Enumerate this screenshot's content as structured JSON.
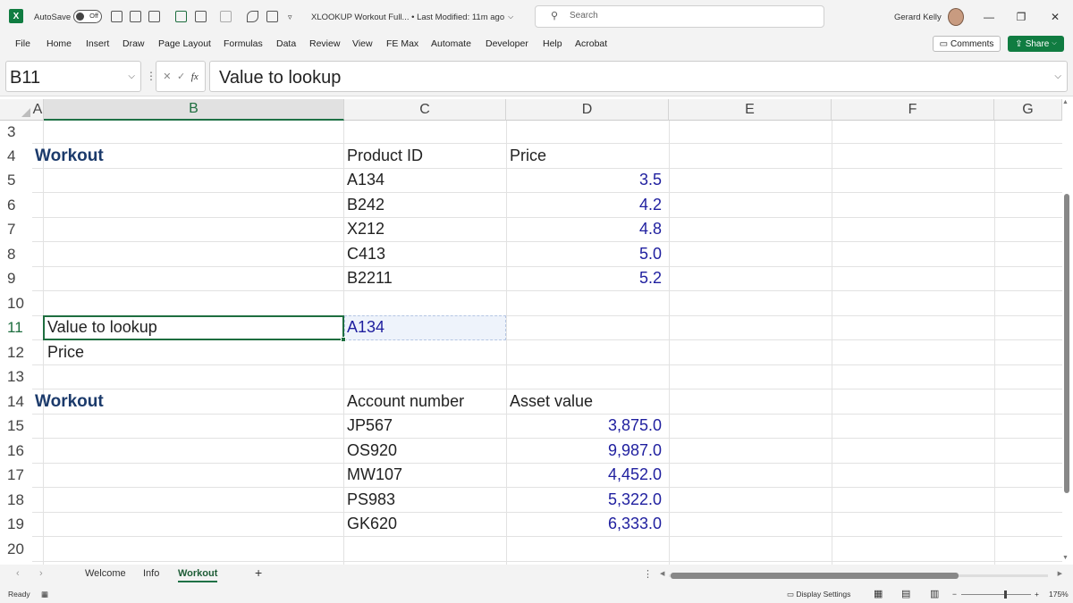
{
  "titlebar": {
    "autosave_label": "AutoSave",
    "autosave_state": "Off",
    "doc_title": "XLOOKUP Workout Full... • Last Modified: 11m ago",
    "search_placeholder": "Search",
    "user_name": "Gerard Kelly",
    "minimize": "—",
    "restore": "❐",
    "close": "✕"
  },
  "menu": {
    "items": [
      "File",
      "Home",
      "Insert",
      "Draw",
      "Page Layout",
      "Formulas",
      "Data",
      "Review",
      "View",
      "FE Max",
      "Automate",
      "Developer",
      "Help",
      "Acrobat"
    ],
    "comments_label": "Comments",
    "share_label": "Share"
  },
  "formula_bar": {
    "name_box": "B11",
    "fx": "fx",
    "content": "Value to lookup"
  },
  "columns": [
    "A",
    "B",
    "C",
    "D",
    "E",
    "F",
    "G"
  ],
  "rows": [
    "3",
    "4",
    "5",
    "6",
    "7",
    "8",
    "9",
    "10",
    "11",
    "12",
    "13",
    "14",
    "15",
    "16",
    "17",
    "18",
    "19",
    "20"
  ],
  "selected": {
    "column": "B",
    "row": "11"
  },
  "cells": {
    "B4": "Workout",
    "C4": "Product ID",
    "D4": "Price",
    "C5": "A134",
    "D5": "3.5",
    "C6": "B242",
    "D6": "4.2",
    "C7": "X212",
    "D7": "4.8",
    "C8": "C413",
    "D8": "5.0",
    "C9": "B2211",
    "D9": "5.2",
    "B11": "Value to lookup",
    "C11": "A134",
    "B12": "Price",
    "B14": "Workout",
    "C14": "Account number",
    "D14": "Asset value",
    "C15": "JP567",
    "D15": "3,875.0",
    "C16": "OS920",
    "D16": "9,987.0",
    "C17": "MW107",
    "D17": "4,452.0",
    "C18": "PS983",
    "D18": "5,322.0",
    "C19": "GK620",
    "D19": "6,333.0"
  },
  "sheets": {
    "tabs": [
      "Welcome",
      "Info",
      "Workout"
    ],
    "active": "Workout",
    "add": "+"
  },
  "status": {
    "ready": "Ready",
    "display_settings": "Display Settings",
    "zoom": "175%"
  }
}
